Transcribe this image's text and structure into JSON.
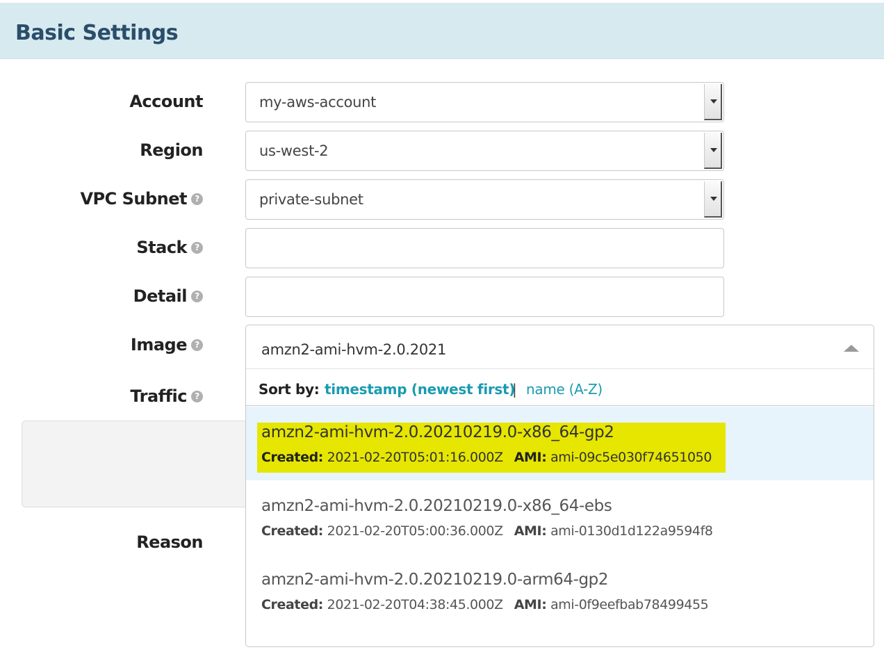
{
  "header": {
    "title": "Basic Settings"
  },
  "form": {
    "account": {
      "label": "Account",
      "value": "my-aws-account"
    },
    "region": {
      "label": "Region",
      "value": "us-west-2"
    },
    "vpc_subnet": {
      "label": "VPC Subnet",
      "value": "private-subnet"
    },
    "stack": {
      "label": "Stack",
      "value": ""
    },
    "detail": {
      "label": "Detail",
      "value": ""
    },
    "image": {
      "label": "Image",
      "value": "amzn2-ami-hvm-2.0.2021"
    },
    "traffic": {
      "label": "Traffic"
    },
    "reason": {
      "label": "Reason"
    },
    "help_icon_glyph": "?"
  },
  "image_dropdown": {
    "sort_label": "Sort by:",
    "sort_active": "timestamp (newest first)",
    "sort_separator": "|",
    "sort_alternative": "name (A-Z)",
    "created_label": "Created:",
    "ami_label": "AMI:",
    "options": [
      {
        "name": "amzn2-ami-hvm-2.0.20210219.0-x86_64-gp2",
        "created": "2021-02-20T05:01:16.000Z",
        "ami": "ami-09c5e030f74651050"
      },
      {
        "name": "amzn2-ami-hvm-2.0.20210219.0-x86_64-ebs",
        "created": "2021-02-20T05:00:36.000Z",
        "ami": "ami-0130d1d122a9594f8"
      },
      {
        "name": "amzn2-ami-hvm-2.0.20210219.0-arm64-gp2",
        "created": "2021-02-20T04:38:45.000Z",
        "ami": "ami-0f9eefbab78499455"
      }
    ]
  },
  "colors": {
    "header_bg": "#d6eaf0",
    "header_text": "#2a4d69",
    "link": "#1a9bb0",
    "selected_option_bg": "#e7f4fb",
    "highlight": "#e6e600"
  }
}
